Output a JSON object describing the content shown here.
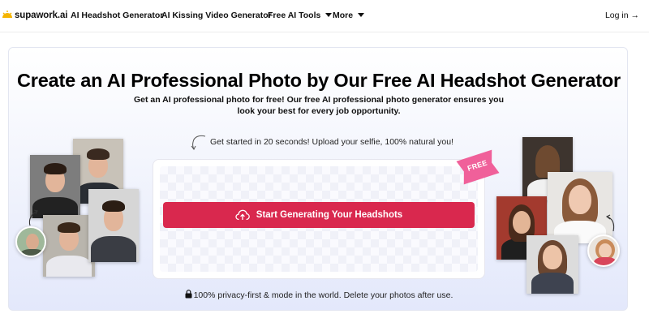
{
  "nav": {
    "logo_text": "supawork.ai",
    "links": [
      {
        "label": "AI Headshot Generator"
      },
      {
        "label": "AI Kissing Video Generator"
      },
      {
        "label": "Free AI Tools"
      },
      {
        "label": "More"
      }
    ],
    "login": "Log in →"
  },
  "hero": {
    "title": "Create an AI Professional Photo by Our Free AI Headshot Generator",
    "subtitle": "Get an AI professional photo for free! Our free AI professional photo generator ensures you look your best for every job opportunity.",
    "started_text": "Get started in 20 seconds! Upload your selfie, 100% natural you!",
    "cta_label": "Start Generating Your Headshots",
    "badge_text": "FREE",
    "privacy_text": "100% privacy-first & mode in the world. Delete your photos after use."
  },
  "colors": {
    "accent": "#d9284e",
    "badge": "#f0609a",
    "logo_sun": "#f5b400"
  },
  "icons": {
    "upload": "cloud-upload-icon",
    "lock": "lock-icon",
    "caret": "chevron-down-icon"
  }
}
